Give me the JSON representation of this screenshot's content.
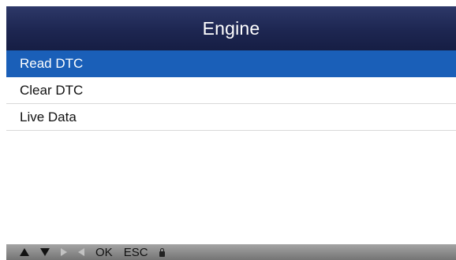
{
  "header": {
    "title": "Engine"
  },
  "menu": {
    "items": [
      {
        "label": "Read DTC",
        "selected": true
      },
      {
        "label": "Clear DTC",
        "selected": false
      },
      {
        "label": "Live Data",
        "selected": false
      }
    ]
  },
  "footer": {
    "ok_label": "OK",
    "esc_label": "ESC",
    "icons": [
      "up-arrow-icon",
      "down-arrow-icon",
      "right-arrow-icon",
      "left-arrow-icon",
      "lock-icon"
    ]
  },
  "colors": {
    "header_bg": "#1d2651",
    "selection_bg": "#1a5fb8",
    "footer_bg": "#8a8a8a"
  }
}
